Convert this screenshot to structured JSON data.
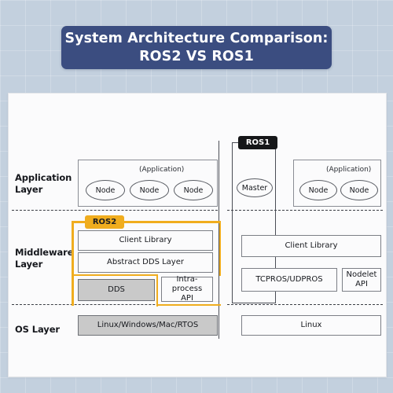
{
  "title": {
    "line1": "System Architecture Comparison:",
    "line2": "ROS2 VS ROS1",
    "banner_color": "#3b4d80",
    "text_color": "#ffffff"
  },
  "canvas": {
    "background_color": "#c3d0de",
    "card_color": "#fbfbfc"
  },
  "row_labels": {
    "application": "Application\nLayer",
    "application_line1": "Application",
    "application_line2": "Layer",
    "middleware_line1": "Middleware",
    "middleware_line2": "Layer",
    "os": "OS Layer"
  },
  "badges": {
    "ros2": {
      "label": "ROS2",
      "bg": "#f0ad1e",
      "fg": "#1c1d20"
    },
    "ros1": {
      "label": "ROS1",
      "bg": "#161719",
      "fg": "#ffffff"
    }
  },
  "ros2_column": {
    "application": {
      "caption": "(Application)",
      "nodes": [
        "Node",
        "Node",
        "Node"
      ]
    },
    "middleware": {
      "client_library": "Client Library",
      "abstract_dds_layer": "Abstract DDS Layer",
      "dds": "DDS",
      "intra_process_api_line1": "Intra-process",
      "intra_process_api_line2": "API",
      "dds_fill": "#c9c9c9"
    },
    "os": {
      "label": "Linux/Windows/Mac/RTOS",
      "fill": "#c9c9c9"
    }
  },
  "ros1_column": {
    "application": {
      "master": "Master",
      "caption": "(Application)",
      "nodes": [
        "Node",
        "Node"
      ]
    },
    "middleware": {
      "client_library": "Client Library",
      "tcpros_udpros": "TCPROS/UDPROS",
      "nodelet_api_line1": "Nodelet",
      "nodelet_api_line2": "API"
    },
    "os": {
      "label": "Linux",
      "fill": "#fbfbfc"
    }
  }
}
